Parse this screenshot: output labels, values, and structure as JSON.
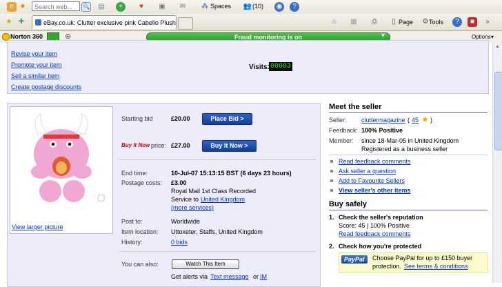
{
  "browser": {
    "search_placeholder": "Search web...",
    "spaces_label": "Spaces",
    "notify_label": "(10)",
    "tab_title": "eBay.co.uk: Clutter exclusive pink Cabello Plush DGPH...",
    "page_menu": "Page",
    "tools_menu": "Tools"
  },
  "norton": {
    "brand": "Norton 360",
    "status": "Fraud monitoring is on",
    "options": "Options"
  },
  "top_links": [
    "Revise your item",
    "Promote your item",
    "Sell a similar item",
    "Create postage discounts"
  ],
  "visits": {
    "label": "Visits:",
    "count": "00003"
  },
  "image": {
    "link": "View larger picture"
  },
  "listing": {
    "starting_bid_label": "Starting bid",
    "starting_bid": "£20.00",
    "place_bid": "Place Bid >",
    "buy_it_now_logo": "Buy It Now",
    "price_label": "price:",
    "bin_price": "£27.00",
    "buy_it_now_btn": "Buy It Now >",
    "end_time_label": "End time:",
    "end_time": "10-Jul-07 15:13:15 BST (6 days 23 hours)",
    "postage_label": "Postage costs:",
    "postage_cost": "£3.00",
    "postage_service_1": "Royal Mail 1st Class Recorded",
    "postage_service_2": "Service to",
    "postage_country": "United Kingdom",
    "more_services": "(more services)",
    "post_to_label": "Post to:",
    "post_to": "Worldwide",
    "location_label": "Item location:",
    "location": "Uttoxeter, Staffs, United Kingdom",
    "history_label": "History:",
    "history": "0 bids",
    "you_can_also": "You can also:",
    "watch": "Watch This Item",
    "alerts_prefix": "Get alerts via",
    "alerts_text": "Text message",
    "alerts_or": "or",
    "alerts_im": "IM"
  },
  "seller": {
    "heading": "Meet the seller",
    "seller_label": "Seller:",
    "name": "cluttermagazine",
    "paren_open": "(",
    "score": "45",
    "paren_close": ")",
    "feedback_label": "Feedback:",
    "feedback": "100% Positive",
    "member_label": "Member:",
    "member_since": "since 18-Mar-05 in United Kingdom",
    "registered": "Registered as a business seller",
    "links": [
      "Read feedback comments",
      "Ask seller a question",
      "Add to Favourite Sellers",
      "View seller's other items"
    ]
  },
  "buy_safely": {
    "heading": "Buy safely",
    "step1_num": "1.",
    "step1_title": "Check the seller's reputation",
    "step1_score": "Score: 45 | 100% Positive",
    "step1_link": "Read feedback comments",
    "step2_num": "2.",
    "step2_title": "Check how you're protected",
    "paypal_logo": "PayPal",
    "paypal_text_1": "Choose PayPal for up to £150 buyer",
    "paypal_text_2": "protection.",
    "paypal_link": "See terms & conditions"
  },
  "colors": {
    "ebay_blue": "#173f96",
    "panel": "#ececfb",
    "link": "#0033cc",
    "fraud_green": "#2e9a2c"
  }
}
